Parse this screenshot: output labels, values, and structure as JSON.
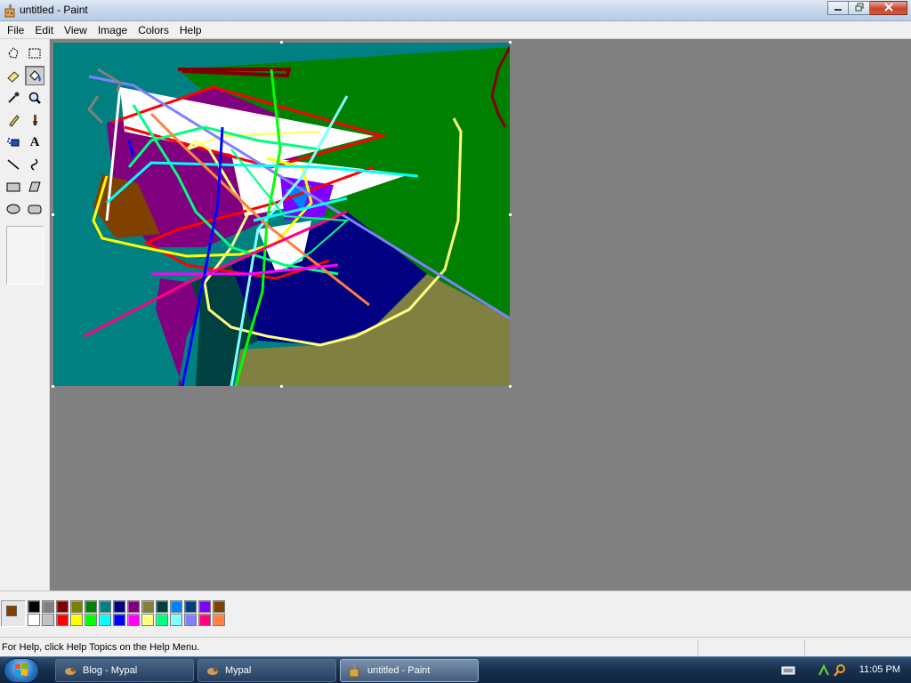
{
  "window": {
    "title": "untitled - Paint",
    "minimize_icon": "minimize-icon",
    "restore_icon": "restore-icon",
    "close_icon": "close-icon"
  },
  "menu": [
    "File",
    "Edit",
    "View",
    "Image",
    "Colors",
    "Help"
  ],
  "tools": [
    {
      "name": "free-form-select-icon"
    },
    {
      "name": "rectangle-select-icon"
    },
    {
      "name": "eraser-icon"
    },
    {
      "name": "fill-bucket-icon",
      "active": true
    },
    {
      "name": "pick-color-icon"
    },
    {
      "name": "magnifier-icon"
    },
    {
      "name": "pencil-icon"
    },
    {
      "name": "brush-icon"
    },
    {
      "name": "airbrush-icon"
    },
    {
      "name": "text-icon",
      "glyph": "A"
    },
    {
      "name": "line-icon"
    },
    {
      "name": "curve-icon"
    },
    {
      "name": "rectangle-icon"
    },
    {
      "name": "polygon-icon"
    },
    {
      "name": "ellipse-icon"
    },
    {
      "name": "rounded-rectangle-icon"
    }
  ],
  "colors": {
    "foreground": "#804000",
    "background": "#ffffff",
    "palette_top": [
      "#000000",
      "#808080",
      "#800000",
      "#808000",
      "#008000",
      "#008080",
      "#000080",
      "#800080",
      "#808040",
      "#004040",
      "#0080ff",
      "#004080",
      "#8000ff",
      "#804000"
    ],
    "palette_bottom": [
      "#ffffff",
      "#c0c0c0",
      "#ff0000",
      "#ffff00",
      "#00ff00",
      "#00ffff",
      "#0000ff",
      "#ff00ff",
      "#ffff80",
      "#00ff80",
      "#80ffff",
      "#8080ff",
      "#ff0080",
      "#ff8040"
    ]
  },
  "status": {
    "help_text": "For Help, click Help Topics on the Help Menu."
  },
  "taskbar": {
    "start_icon": "windows-start-icon",
    "buttons": [
      {
        "label": "Blog - Mypal",
        "icon": "mypal-icon",
        "active": false
      },
      {
        "label": "Mypal",
        "icon": "mypal-icon",
        "active": false
      },
      {
        "label": "untitled - Paint",
        "icon": "paint-icon",
        "active": true
      }
    ],
    "tray_icons": [
      "keyboard-icon",
      "network-icon",
      "search-icon"
    ],
    "clock": "11:05 PM"
  }
}
